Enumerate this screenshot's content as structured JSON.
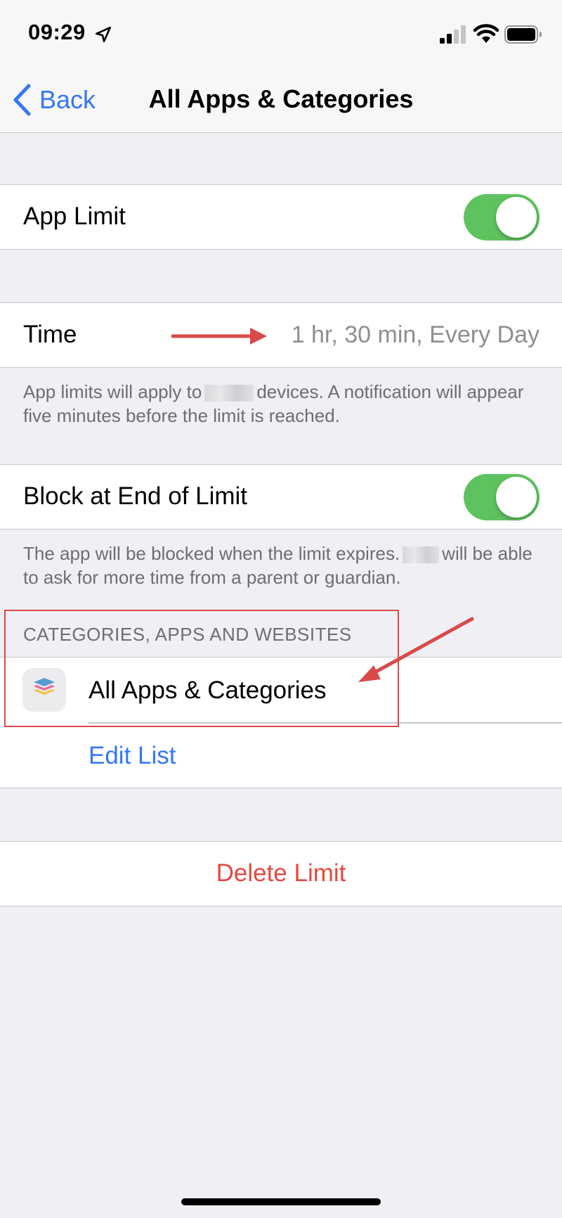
{
  "status_bar": {
    "time": "09:29",
    "icons": [
      "location-arrow-icon",
      "cellular-signal-icon",
      "wifi-icon",
      "battery-icon"
    ]
  },
  "nav": {
    "back_label": "Back",
    "title": "All Apps & Categories"
  },
  "app_limit": {
    "label": "App Limit",
    "toggle_on": true
  },
  "time": {
    "label": "Time",
    "value": "1 hr, 30 min, Every Day"
  },
  "time_footer": {
    "part1": "App limits will apply to",
    "part2": "devices. A notification will appear five minutes before the limit is reached."
  },
  "block_at_end": {
    "label": "Block at End of Limit",
    "toggle_on": true
  },
  "block_footer": {
    "part1": "The app will be blocked when the limit expires.",
    "part2": "will be able to ask for more time from a parent or guardian."
  },
  "categories": {
    "header": "CATEGORIES, APPS AND WEBSITES",
    "item_label": "All Apps & Categories",
    "item_icon": "stacked-layers-icon",
    "edit_label": "Edit List"
  },
  "delete": {
    "label": "Delete Limit"
  },
  "colors": {
    "accent_blue": "#3478f6",
    "toggle_green": "#5ec35f",
    "destructive_red": "#e5483f",
    "annotation_red": "#d94a4a",
    "background": "#efeff4"
  }
}
